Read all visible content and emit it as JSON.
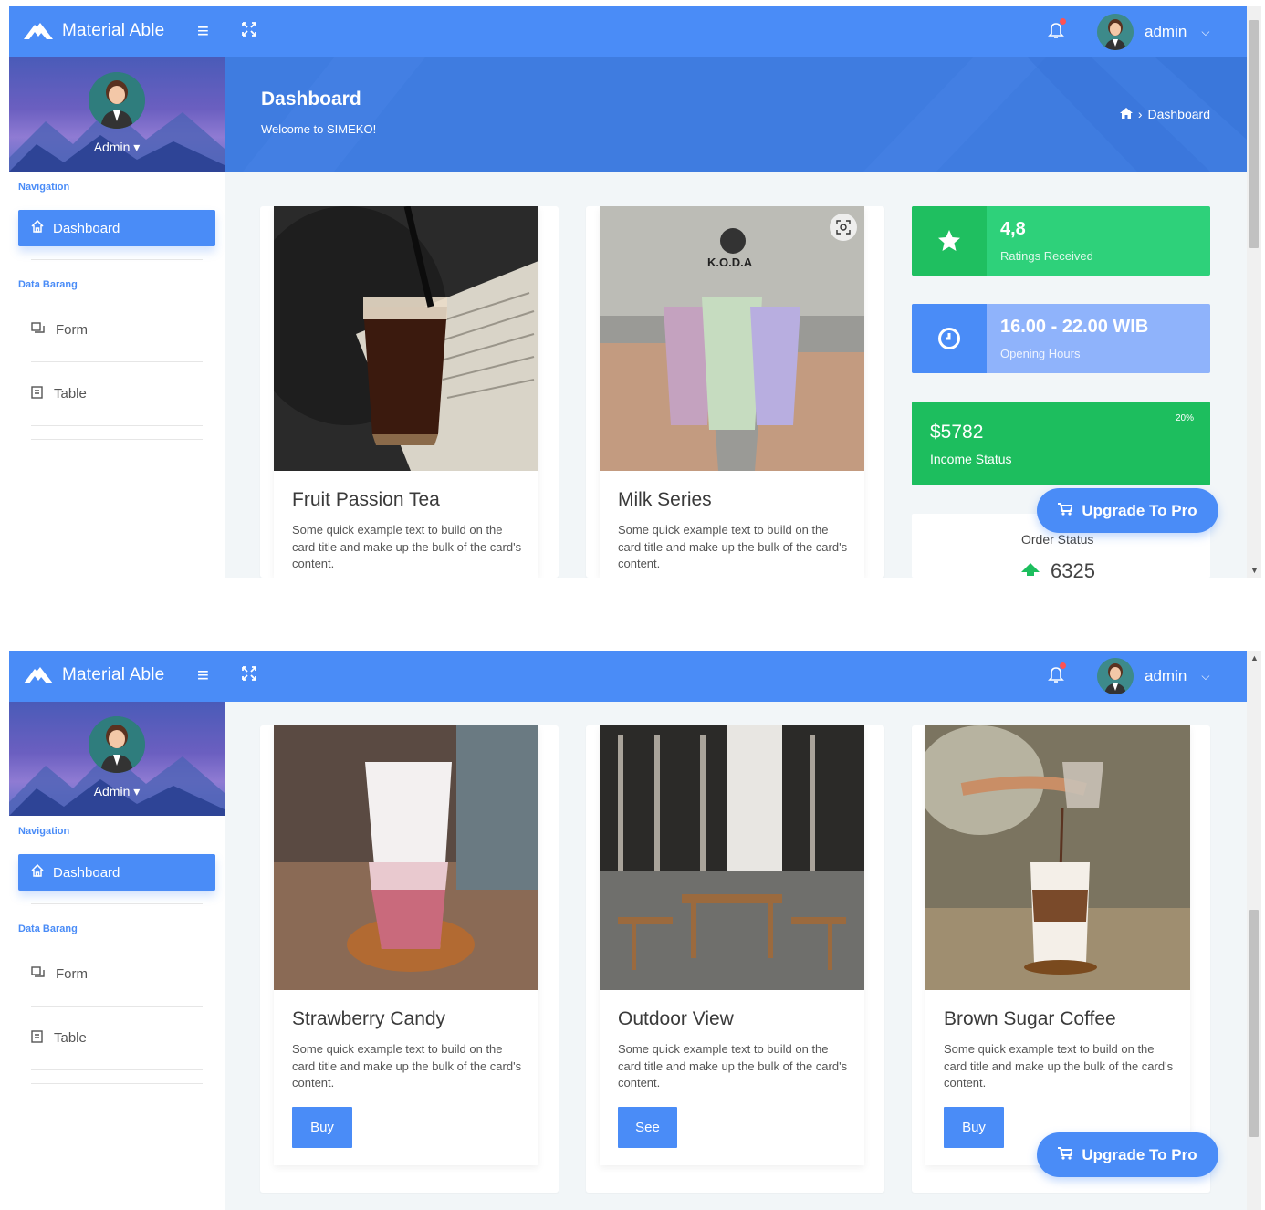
{
  "app": {
    "brand": "Material Able"
  },
  "topbar": {
    "user_name": "admin"
  },
  "sidebar": {
    "profile_name": "Admin",
    "nav_caption": "Navigation",
    "dashboard_label": "Dashboard",
    "data_caption": "Data Barang",
    "form_label": "Form",
    "table_label": "Table"
  },
  "header": {
    "title": "Dashboard",
    "subtitle": "Welcome to SIMEKO!",
    "breadcrumb": "Dashboard"
  },
  "cards_top": [
    {
      "title": "Fruit Passion Tea",
      "text": "Some quick example text to build on the card title and make up the bulk of the card's content."
    },
    {
      "title": "Milk Series",
      "text": "Some quick example text to build on the card title and make up the bulk of the card's content.",
      "logo": "K.O.D.A"
    }
  ],
  "stats": {
    "ratings": {
      "value": "4,8",
      "label": "Ratings Received",
      "color": "#2ed17a"
    },
    "hours": {
      "value": "16.00 - 22.00 WIB",
      "label": "Opening Hours",
      "color": "#8fb3fb"
    },
    "income": {
      "value": "$5782",
      "label": "Income Status",
      "percent": "20%",
      "color": "#1dbe5e"
    },
    "order": {
      "label": "Order Status",
      "value": "6325"
    }
  },
  "upgrade_label": "Upgrade To Pro",
  "cards_bottom": [
    {
      "title": "Strawberry Candy",
      "text": "Some quick example text to build on the card title and make up the bulk of the card's content.",
      "button": "Buy"
    },
    {
      "title": "Outdoor View",
      "text": "Some quick example text to build on the card title and make up the bulk of the card's content.",
      "button": "See"
    },
    {
      "title": "Brown Sugar Coffee",
      "text": "Some quick example text to build on the card title and make up the bulk of the card's content.",
      "button": "Buy"
    }
  ],
  "colors": {
    "primary": "#4a8cf7",
    "header": "#3f7ce0",
    "background": "#f2f6f8"
  }
}
